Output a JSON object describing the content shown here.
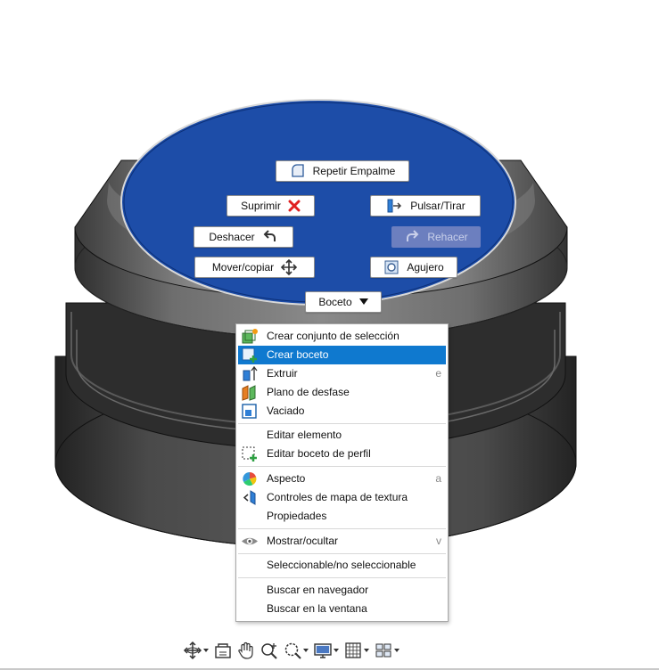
{
  "marking_menu": {
    "repeat_fillet": "Repetir Empalme",
    "delete": "Suprimir",
    "press_pull": "Pulsar/Tirar",
    "undo": "Deshacer",
    "redo": "Rehacer",
    "move_copy": "Mover/copiar",
    "hole": "Agujero",
    "sketch": "Boceto"
  },
  "context_menu": {
    "items": [
      {
        "label": "Crear conjunto de selección",
        "shortcut": "",
        "icon": "selection-set-icon"
      },
      {
        "label": "Crear boceto",
        "shortcut": "",
        "icon": "create-sketch-icon"
      },
      {
        "label": "Extruir",
        "shortcut": "e",
        "icon": "extrude-icon"
      },
      {
        "label": "Plano de desfase",
        "shortcut": "",
        "icon": "offset-plane-icon"
      },
      {
        "label": "Vaciado",
        "shortcut": "",
        "icon": "shell-icon"
      },
      {
        "label": "Editar elemento",
        "shortcut": "",
        "icon": ""
      },
      {
        "label": "Editar boceto de perfil",
        "shortcut": "",
        "icon": "edit-profile-sketch-icon"
      },
      {
        "label": "Aspecto",
        "shortcut": "a",
        "icon": "appearance-icon"
      },
      {
        "label": "Controles de mapa de textura",
        "shortcut": "",
        "icon": "texture-map-icon"
      },
      {
        "label": "Propiedades",
        "shortcut": "",
        "icon": ""
      },
      {
        "label": "Mostrar/ocultar",
        "shortcut": "v",
        "icon": "eye-icon"
      },
      {
        "label": "Seleccionable/no seleccionable",
        "shortcut": "",
        "icon": ""
      },
      {
        "label": "Buscar en navegador",
        "shortcut": "",
        "icon": ""
      },
      {
        "label": "Buscar en la ventana",
        "shortcut": "",
        "icon": ""
      }
    ],
    "highlighted_index": 1
  },
  "colors": {
    "selected_face": "#1d4da8",
    "menu_highlight": "#0f79cf",
    "model_gray": "#4a4a4a"
  }
}
